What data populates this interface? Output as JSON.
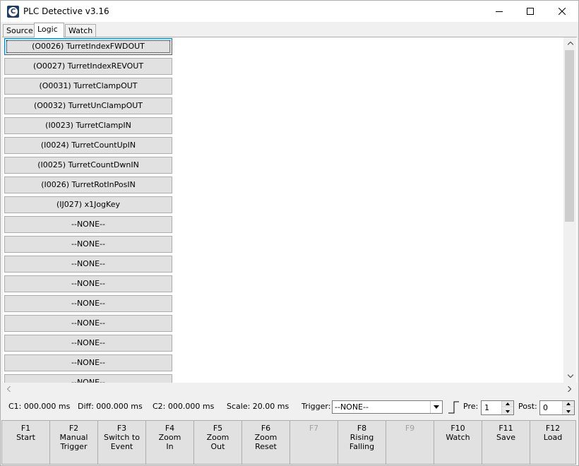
{
  "window": {
    "title": "PLC Detective v3.16",
    "icon_letter": "C"
  },
  "tabs": [
    {
      "label": "Source",
      "active": false
    },
    {
      "label": "Logic",
      "active": true
    },
    {
      "label": "Watch",
      "active": false
    }
  ],
  "signals": [
    "(O0026) TurretIndexFWDOUT",
    "(O0027) TurretIndexREVOUT",
    "(O0031) TurretClampOUT",
    "(O0032) TurretUnClampOUT",
    "(I0023) TurretClampIN",
    "(I0024) TurretCountUpIN",
    "(I0025) TurretCountDwnIN",
    "(I0026) TurretRotInPosIN",
    "(IJ027) x1JogKey",
    "--NONE--",
    "--NONE--",
    "--NONE--",
    "--NONE--",
    "--NONE--",
    "--NONE--",
    "--NONE--",
    "--NONE--",
    "--NONE--"
  ],
  "status": {
    "c1": "C1: 000.000 ms",
    "diff": "Diff: 000.000 ms",
    "c2": "C2: 000.000 ms",
    "scale": "Scale: 20.00 ms",
    "trigger_label": "Trigger:",
    "trigger_value": "--NONE--",
    "pre_label": "Pre:",
    "pre_value": "1",
    "post_label": "Post:",
    "post_value": "0"
  },
  "fkeys": [
    {
      "key": "F1",
      "line1": "Start",
      "line2": "",
      "enabled": true
    },
    {
      "key": "F2",
      "line1": "Manual",
      "line2": "Trigger",
      "enabled": true
    },
    {
      "key": "F3",
      "line1": "Switch to",
      "line2": "Event",
      "enabled": true
    },
    {
      "key": "F4",
      "line1": "Zoom",
      "line2": "In",
      "enabled": true
    },
    {
      "key": "F5",
      "line1": "Zoom",
      "line2": "Out",
      "enabled": true
    },
    {
      "key": "F6",
      "line1": "Zoom",
      "line2": "Reset",
      "enabled": true
    },
    {
      "key": "F7",
      "line1": "",
      "line2": "",
      "enabled": false
    },
    {
      "key": "F8",
      "line1": "Rising",
      "line2": "Falling",
      "enabled": true
    },
    {
      "key": "F9",
      "line1": "",
      "line2": "",
      "enabled": false
    },
    {
      "key": "F10",
      "line1": "Watch",
      "line2": "",
      "enabled": true
    },
    {
      "key": "F11",
      "line1": "Save",
      "line2": "",
      "enabled": true
    },
    {
      "key": "F12",
      "line1": "Load",
      "line2": "",
      "enabled": true
    }
  ],
  "icons": {
    "app": "app-icon",
    "minimize": "minimize-icon",
    "maximize": "maximize-icon",
    "close": "close-icon",
    "scroll_up": "arrow-up-icon",
    "scroll_down": "arrow-down-icon",
    "scroll_left": "arrow-left-icon",
    "scroll_right": "arrow-right-icon",
    "combo": "chevron-down-icon",
    "edge": "rising-edge-icon"
  }
}
